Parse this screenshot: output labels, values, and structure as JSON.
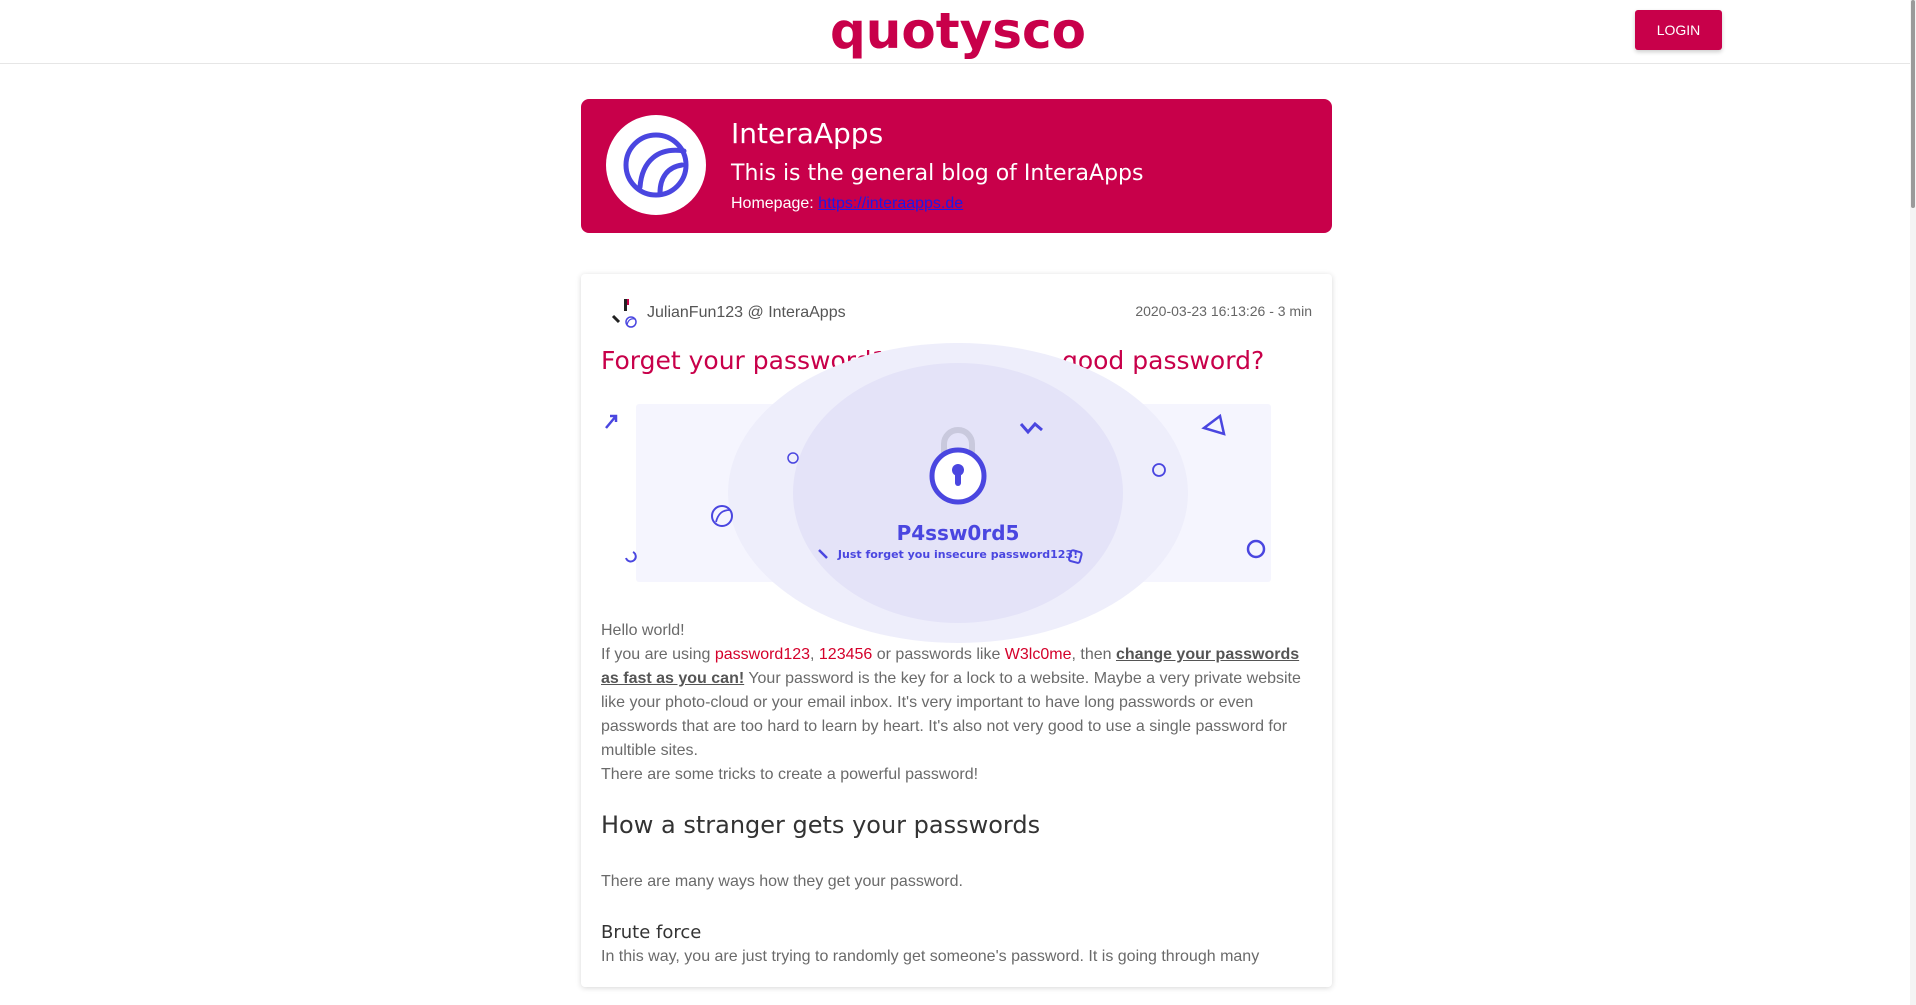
{
  "topbar": {
    "logo": "quotysco",
    "login_label": "LOGIN"
  },
  "blog": {
    "name": "InteraApps",
    "description": "This is the general blog of InteraApps",
    "homepage_label": "Homepage:",
    "homepage_url": "https://interaapps.de"
  },
  "post": {
    "author": "JulianFun123 @ InteraApps",
    "meta": "2020-03-23 16:13:26 - 3 min",
    "title": "Forget your password123! What is a good password?",
    "image": {
      "headline": "P4ssw0rd5",
      "caption": "Just forget you insecure password123!"
    },
    "body": {
      "greeting": "Hello world!",
      "intro_1": "If you are using ",
      "pw1": "password123",
      "sep1": ", ",
      "pw2": "123456",
      "intro_2": " or passwords like ",
      "pw3": "W3lc0me",
      "intro_3": ", then ",
      "strong": "change your passwords as fast as you can!",
      "rest": " Your password is the key for a lock to a website. Maybe a very private website like your photo-cloud or your email inbox. It's very important to have long passwords or even passwords that are too hard to learn by heart. It's also not very good to use a single password for multible sites.",
      "tricks": "There are some tricks to create a powerful password!"
    },
    "section_heading": "How a stranger gets your passwords",
    "section_text": "There are many ways how they get your password.",
    "sub_heading": "Brute force",
    "sub_text": "In this way, you are just trying to randomly get someone's password. It is going through many"
  },
  "colors": {
    "brand": "#c8004a",
    "accent": "#4a46e0"
  }
}
